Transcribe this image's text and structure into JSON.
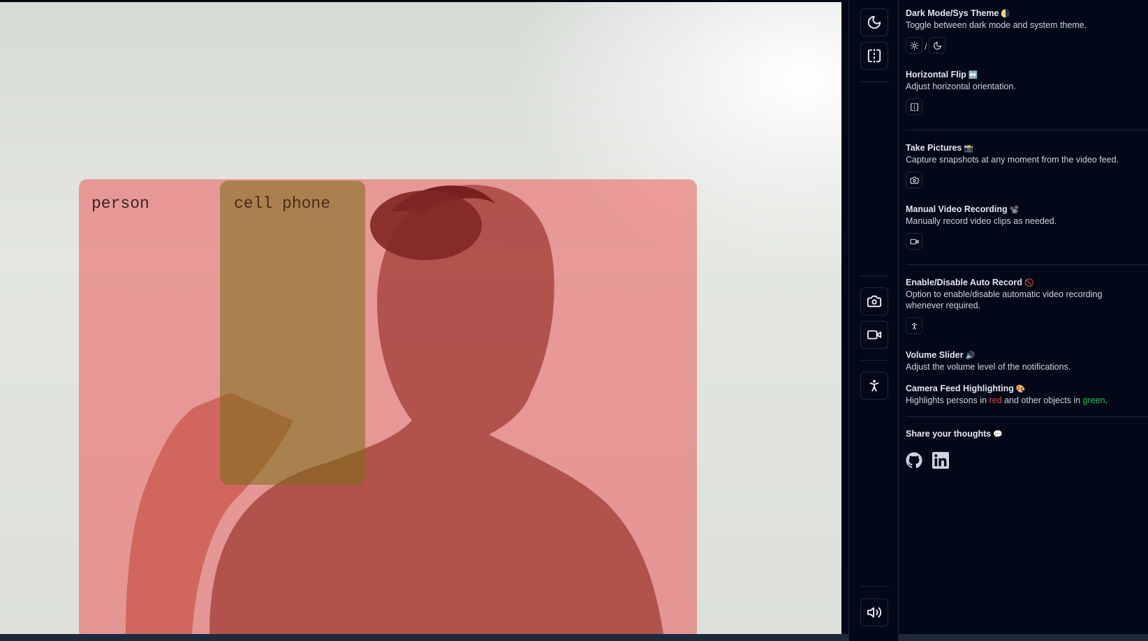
{
  "feed": {
    "detections": [
      {
        "label": "person",
        "color": "#ee2828"
      },
      {
        "label": "cell phone",
        "color": "#786e14"
      }
    ]
  },
  "rail": {
    "top_buttons": [
      "moon-icon",
      "flip-horizontal-icon"
    ],
    "middle_buttons": [
      "camera-icon",
      "video-icon"
    ],
    "accessibility_button": "person-standing-icon",
    "bottom_button": "volume-icon"
  },
  "panel": {
    "dark_mode": {
      "title": "Dark Mode/Sys Theme",
      "emoji": "🌗",
      "desc": "Toggle between dark mode and system theme.",
      "separator": "/"
    },
    "flip": {
      "title": "Horizontal Flip",
      "emoji": "↔️",
      "desc": "Adjust horizontal orientation."
    },
    "pictures": {
      "title": "Take Pictures",
      "emoji": "📸",
      "desc": "Capture snapshots at any moment from the video feed."
    },
    "recording": {
      "title": "Manual Video Recording",
      "emoji": "📽️",
      "desc": "Manually record video clips as needed."
    },
    "auto_record": {
      "title": "Enable/Disable Auto Record",
      "emoji": "🚫",
      "desc": "Option to enable/disable automatic video recording whenever required."
    },
    "volume": {
      "title": "Volume Slider",
      "emoji": "🔊",
      "desc": "Adjust the volume level of the notifications."
    },
    "highlighting": {
      "title": "Camera Feed Highlighting",
      "emoji": "🎨",
      "desc_prefix": "Highlights persons in ",
      "red_word": "red",
      "desc_middle": " and other objects in ",
      "green_word": "green",
      "desc_suffix": "."
    },
    "share": {
      "title": "Share your thoughts",
      "emoji": "💬"
    }
  },
  "colors": {
    "background": "#020817",
    "border": "#1e293b",
    "text": "#cbd5e1",
    "red": "#ef4444",
    "green": "#22c55e"
  }
}
